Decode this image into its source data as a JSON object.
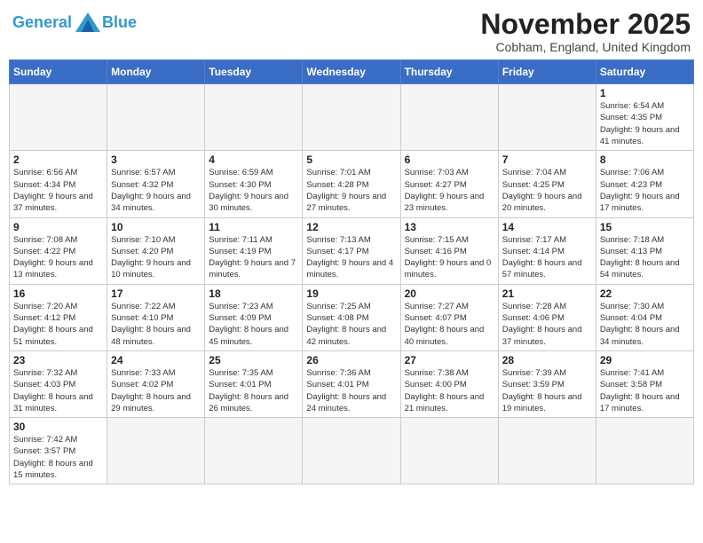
{
  "header": {
    "logo_general": "General",
    "logo_blue": "Blue",
    "month_title": "November 2025",
    "location": "Cobham, England, United Kingdom"
  },
  "days_of_week": [
    "Sunday",
    "Monday",
    "Tuesday",
    "Wednesday",
    "Thursday",
    "Friday",
    "Saturday"
  ],
  "weeks": [
    [
      {
        "day": "",
        "info": ""
      },
      {
        "day": "",
        "info": ""
      },
      {
        "day": "",
        "info": ""
      },
      {
        "day": "",
        "info": ""
      },
      {
        "day": "",
        "info": ""
      },
      {
        "day": "",
        "info": ""
      },
      {
        "day": "1",
        "info": "Sunrise: 6:54 AM\nSunset: 4:35 PM\nDaylight: 9 hours and 41 minutes."
      }
    ],
    [
      {
        "day": "2",
        "info": "Sunrise: 6:56 AM\nSunset: 4:34 PM\nDaylight: 9 hours and 37 minutes."
      },
      {
        "day": "3",
        "info": "Sunrise: 6:57 AM\nSunset: 4:32 PM\nDaylight: 9 hours and 34 minutes."
      },
      {
        "day": "4",
        "info": "Sunrise: 6:59 AM\nSunset: 4:30 PM\nDaylight: 9 hours and 30 minutes."
      },
      {
        "day": "5",
        "info": "Sunrise: 7:01 AM\nSunset: 4:28 PM\nDaylight: 9 hours and 27 minutes."
      },
      {
        "day": "6",
        "info": "Sunrise: 7:03 AM\nSunset: 4:27 PM\nDaylight: 9 hours and 23 minutes."
      },
      {
        "day": "7",
        "info": "Sunrise: 7:04 AM\nSunset: 4:25 PM\nDaylight: 9 hours and 20 minutes."
      },
      {
        "day": "8",
        "info": "Sunrise: 7:06 AM\nSunset: 4:23 PM\nDaylight: 9 hours and 17 minutes."
      }
    ],
    [
      {
        "day": "9",
        "info": "Sunrise: 7:08 AM\nSunset: 4:22 PM\nDaylight: 9 hours and 13 minutes."
      },
      {
        "day": "10",
        "info": "Sunrise: 7:10 AM\nSunset: 4:20 PM\nDaylight: 9 hours and 10 minutes."
      },
      {
        "day": "11",
        "info": "Sunrise: 7:11 AM\nSunset: 4:19 PM\nDaylight: 9 hours and 7 minutes."
      },
      {
        "day": "12",
        "info": "Sunrise: 7:13 AM\nSunset: 4:17 PM\nDaylight: 9 hours and 4 minutes."
      },
      {
        "day": "13",
        "info": "Sunrise: 7:15 AM\nSunset: 4:16 PM\nDaylight: 9 hours and 0 minutes."
      },
      {
        "day": "14",
        "info": "Sunrise: 7:17 AM\nSunset: 4:14 PM\nDaylight: 8 hours and 57 minutes."
      },
      {
        "day": "15",
        "info": "Sunrise: 7:18 AM\nSunset: 4:13 PM\nDaylight: 8 hours and 54 minutes."
      }
    ],
    [
      {
        "day": "16",
        "info": "Sunrise: 7:20 AM\nSunset: 4:12 PM\nDaylight: 8 hours and 51 minutes."
      },
      {
        "day": "17",
        "info": "Sunrise: 7:22 AM\nSunset: 4:10 PM\nDaylight: 8 hours and 48 minutes."
      },
      {
        "day": "18",
        "info": "Sunrise: 7:23 AM\nSunset: 4:09 PM\nDaylight: 8 hours and 45 minutes."
      },
      {
        "day": "19",
        "info": "Sunrise: 7:25 AM\nSunset: 4:08 PM\nDaylight: 8 hours and 42 minutes."
      },
      {
        "day": "20",
        "info": "Sunrise: 7:27 AM\nSunset: 4:07 PM\nDaylight: 8 hours and 40 minutes."
      },
      {
        "day": "21",
        "info": "Sunrise: 7:28 AM\nSunset: 4:06 PM\nDaylight: 8 hours and 37 minutes."
      },
      {
        "day": "22",
        "info": "Sunrise: 7:30 AM\nSunset: 4:04 PM\nDaylight: 8 hours and 34 minutes."
      }
    ],
    [
      {
        "day": "23",
        "info": "Sunrise: 7:32 AM\nSunset: 4:03 PM\nDaylight: 8 hours and 31 minutes."
      },
      {
        "day": "24",
        "info": "Sunrise: 7:33 AM\nSunset: 4:02 PM\nDaylight: 8 hours and 29 minutes."
      },
      {
        "day": "25",
        "info": "Sunrise: 7:35 AM\nSunset: 4:01 PM\nDaylight: 8 hours and 26 minutes."
      },
      {
        "day": "26",
        "info": "Sunrise: 7:36 AM\nSunset: 4:01 PM\nDaylight: 8 hours and 24 minutes."
      },
      {
        "day": "27",
        "info": "Sunrise: 7:38 AM\nSunset: 4:00 PM\nDaylight: 8 hours and 21 minutes."
      },
      {
        "day": "28",
        "info": "Sunrise: 7:39 AM\nSunset: 3:59 PM\nDaylight: 8 hours and 19 minutes."
      },
      {
        "day": "29",
        "info": "Sunrise: 7:41 AM\nSunset: 3:58 PM\nDaylight: 8 hours and 17 minutes."
      }
    ],
    [
      {
        "day": "30",
        "info": "Sunrise: 7:42 AM\nSunset: 3:57 PM\nDaylight: 8 hours and 15 minutes."
      },
      {
        "day": "",
        "info": ""
      },
      {
        "day": "",
        "info": ""
      },
      {
        "day": "",
        "info": ""
      },
      {
        "day": "",
        "info": ""
      },
      {
        "day": "",
        "info": ""
      },
      {
        "day": "",
        "info": ""
      }
    ]
  ]
}
